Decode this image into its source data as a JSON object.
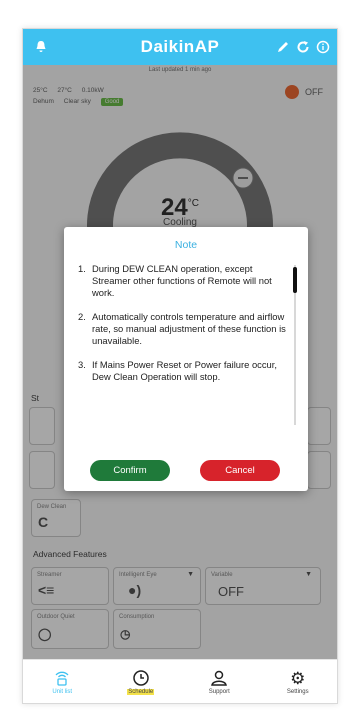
{
  "app": {
    "title": "DaikinAP",
    "subtitle": "Last updated 1 min ago"
  },
  "status": {
    "indoor": "25°C",
    "outdoor": "27°C",
    "power": "0.10kW",
    "mode_label": "Dehum",
    "weather": "Clear sky",
    "badge": "Good",
    "power_state": "OFF"
  },
  "dial": {
    "temperature": "24",
    "unit": "°C",
    "mode": "Cooling"
  },
  "sections": {
    "standard_label": "St",
    "advanced_label": "Advanced Features"
  },
  "tiles": {
    "dew_clean": "Dew Clean",
    "streamer": "Streamer",
    "intelligent_eye": "Intelligent Eye",
    "variable": "Variable",
    "variable_value": "OFF",
    "outdoor_quiet": "Outdoor Quiet",
    "consumption": "Consumption"
  },
  "modal": {
    "title": "Note",
    "items": [
      {
        "num": "1.",
        "text": "During DEW CLEAN operation, except Streamer other functions of Remote will not work."
      },
      {
        "num": "2.",
        "text": "Automatically controls temperature and airflow rate, so manual adjustment of these function is unavailable."
      },
      {
        "num": "3.",
        "text": "If Mains Power Reset or Power failure occur, Dew Clean Operation will stop."
      }
    ],
    "confirm_label": "Confirm",
    "cancel_label": "Cancel"
  },
  "nav": {
    "items": [
      {
        "label": "Unit list",
        "icon": "router-icon"
      },
      {
        "label": "Schedule",
        "icon": "clock-icon"
      },
      {
        "label": "Support",
        "icon": "person-icon"
      },
      {
        "label": "Settings",
        "icon": "gear-icon"
      }
    ]
  },
  "colors": {
    "accent": "#3ec1f0",
    "confirm": "#1f7a3a",
    "cancel": "#d7232b",
    "power": "#f06b35"
  }
}
